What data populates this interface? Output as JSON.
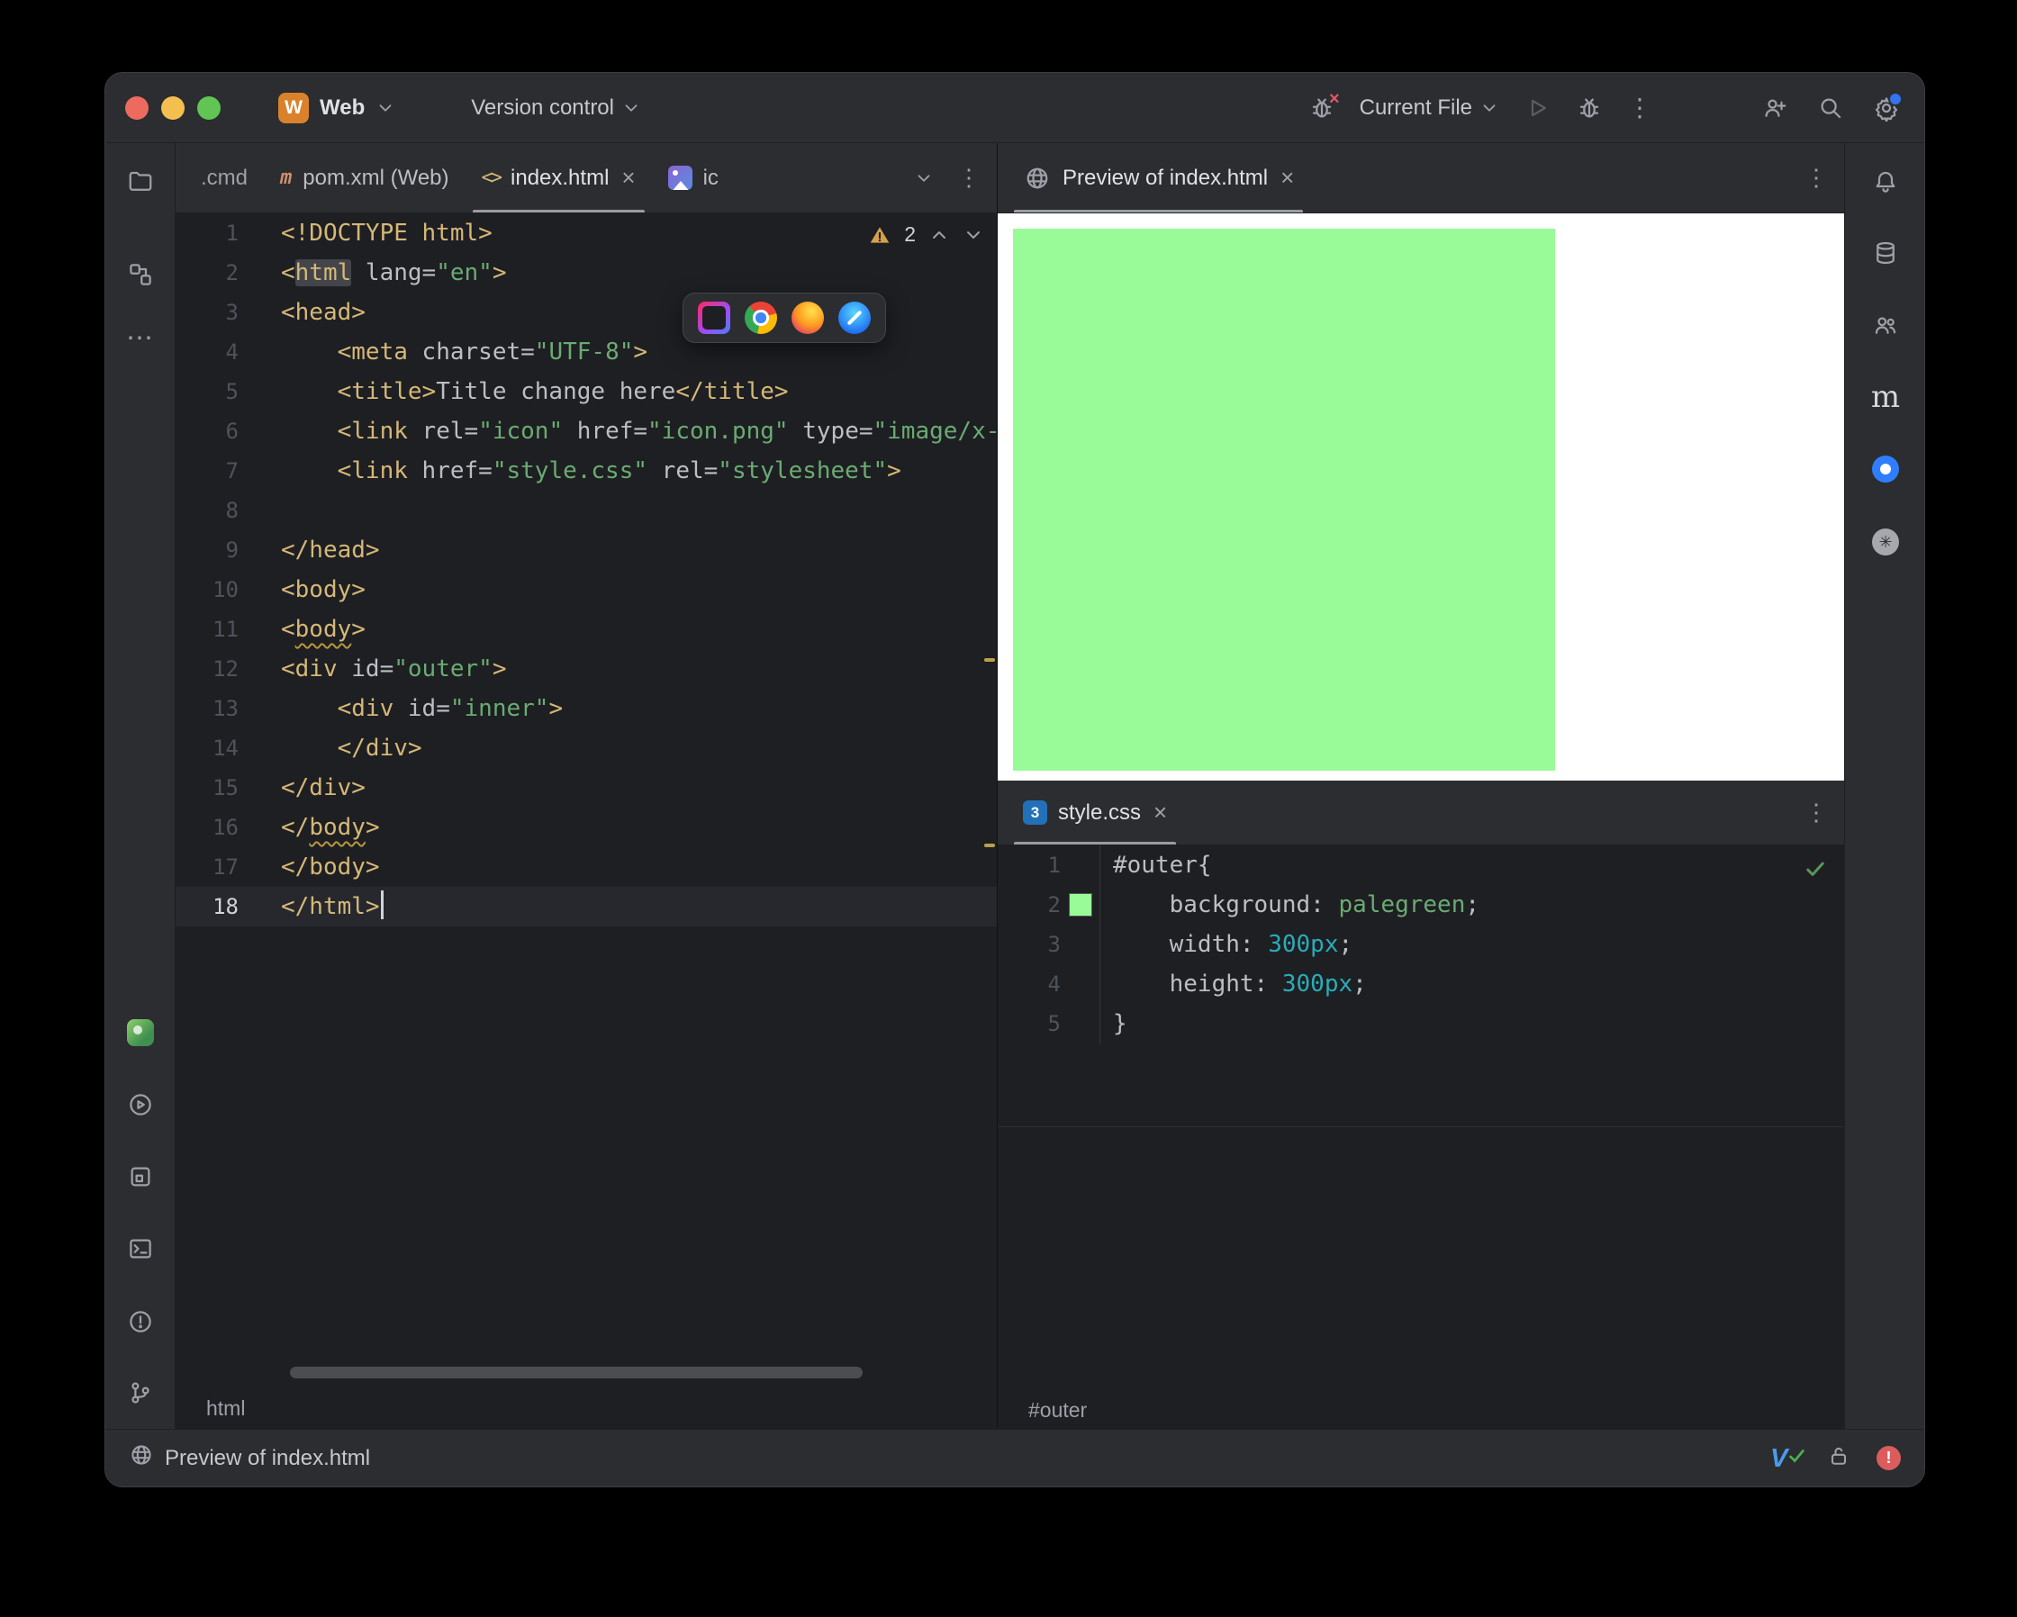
{
  "colors": {
    "palegreen": "#98FB98",
    "accent_blue": "#3574F0",
    "warning_yellow": "#D5A14E",
    "ok_green": "#57965C",
    "error_red": "#DB5C5C"
  },
  "titlebar": {
    "project_badge": "W",
    "project": "Web",
    "vcs": "Version control",
    "run_config": "Current File"
  },
  "icons": {
    "maven": "m",
    "html_file": "<>",
    "css_file": "3",
    "close": "×",
    "kebab": "⋮",
    "more": "⋯",
    "swirl": "✳",
    "m_logo": "m"
  },
  "editor_tabs": {
    "overflow": ".cmd",
    "pom": "pom.xml (Web)",
    "index": "index.html",
    "image_truncated": "ic"
  },
  "inspections": {
    "warning_count": "2"
  },
  "html_editor": {
    "breadcrumb": "html",
    "lines": [
      {
        "n": 1,
        "segs": [
          [
            "tag",
            "<!DOCTYPE html>"
          ]
        ]
      },
      {
        "n": 2,
        "segs": [
          [
            "tag",
            "<"
          ],
          [
            "tag hl",
            "html"
          ],
          [
            "attr",
            " lang="
          ],
          [
            "str",
            "\"en\""
          ],
          [
            "tag",
            ">"
          ]
        ]
      },
      {
        "n": 3,
        "segs": [
          [
            "tag",
            "<head>"
          ]
        ]
      },
      {
        "n": 4,
        "segs": [
          [
            "plain",
            "    "
          ],
          [
            "tag",
            "<meta"
          ],
          [
            "attr",
            " charset="
          ],
          [
            "str",
            "\"UTF-8\""
          ],
          [
            "tag",
            ">"
          ]
        ]
      },
      {
        "n": 5,
        "segs": [
          [
            "plain",
            "    "
          ],
          [
            "tag",
            "<title>"
          ],
          [
            "plain",
            "Title change here"
          ],
          [
            "tag",
            "</title>"
          ]
        ]
      },
      {
        "n": 6,
        "segs": [
          [
            "plain",
            "    "
          ],
          [
            "tag",
            "<link"
          ],
          [
            "attr",
            " rel="
          ],
          [
            "str",
            "\"icon\""
          ],
          [
            "attr",
            " href="
          ],
          [
            "str",
            "\"icon.png\""
          ],
          [
            "attr",
            " type="
          ],
          [
            "str",
            "\"image/x-"
          ]
        ]
      },
      {
        "n": 7,
        "segs": [
          [
            "plain",
            "    "
          ],
          [
            "tag",
            "<link"
          ],
          [
            "attr",
            " href="
          ],
          [
            "str",
            "\"style.css\""
          ],
          [
            "attr",
            " rel="
          ],
          [
            "str",
            "\"stylesheet\""
          ],
          [
            "tag",
            ">"
          ]
        ]
      },
      {
        "n": 8,
        "segs": []
      },
      {
        "n": 9,
        "segs": [
          [
            "tag",
            "</head>"
          ]
        ]
      },
      {
        "n": 10,
        "segs": [
          [
            "tag",
            "<body>"
          ]
        ]
      },
      {
        "n": 11,
        "segs": [
          [
            "tag",
            "<"
          ],
          [
            "tag warn",
            "body"
          ],
          [
            "tag",
            ">"
          ]
        ]
      },
      {
        "n": 12,
        "segs": [
          [
            "tag",
            "<div"
          ],
          [
            "attr",
            " id="
          ],
          [
            "str",
            "\"outer\""
          ],
          [
            "tag",
            ">"
          ]
        ]
      },
      {
        "n": 13,
        "segs": [
          [
            "plain",
            "    "
          ],
          [
            "tag",
            "<div"
          ],
          [
            "attr",
            " id="
          ],
          [
            "str",
            "\"inner\""
          ],
          [
            "tag",
            ">"
          ]
        ]
      },
      {
        "n": 14,
        "segs": [
          [
            "plain",
            "    "
          ],
          [
            "tag",
            "</div>"
          ]
        ]
      },
      {
        "n": 15,
        "segs": [
          [
            "tag",
            "</div>"
          ]
        ]
      },
      {
        "n": 16,
        "segs": [
          [
            "tag",
            "</"
          ],
          [
            "tag warn",
            "body"
          ],
          [
            "tag",
            ">"
          ]
        ]
      },
      {
        "n": 17,
        "segs": [
          [
            "tag",
            "</body>"
          ]
        ]
      },
      {
        "n": 18,
        "current": true,
        "caret": true,
        "segs": [
          [
            "tag",
            "</html>"
          ]
        ]
      }
    ]
  },
  "preview_panel": {
    "tab": "Preview of index.html"
  },
  "css_panel": {
    "tab": "style.css",
    "breadcrumb": "#outer",
    "lines": [
      {
        "n": 1,
        "segs": [
          [
            "plain",
            "#outer{"
          ]
        ]
      },
      {
        "n": 2,
        "swatch": true,
        "segs": [
          [
            "plain",
            "    background"
          ],
          [
            "plain",
            ": "
          ],
          [
            "val",
            "palegreen"
          ],
          [
            "plain",
            ";"
          ]
        ]
      },
      {
        "n": 3,
        "segs": [
          [
            "plain",
            "    width"
          ],
          [
            "plain",
            ": "
          ],
          [
            "num",
            "300px"
          ],
          [
            "plain",
            ";"
          ]
        ]
      },
      {
        "n": 4,
        "segs": [
          [
            "plain",
            "    height"
          ],
          [
            "plain",
            ": "
          ],
          [
            "num",
            "300px"
          ],
          [
            "plain",
            ";"
          ]
        ]
      },
      {
        "n": 5,
        "segs": [
          [
            "plain",
            "}"
          ]
        ]
      }
    ]
  },
  "statusbar": {
    "message": "Preview of index.html"
  }
}
